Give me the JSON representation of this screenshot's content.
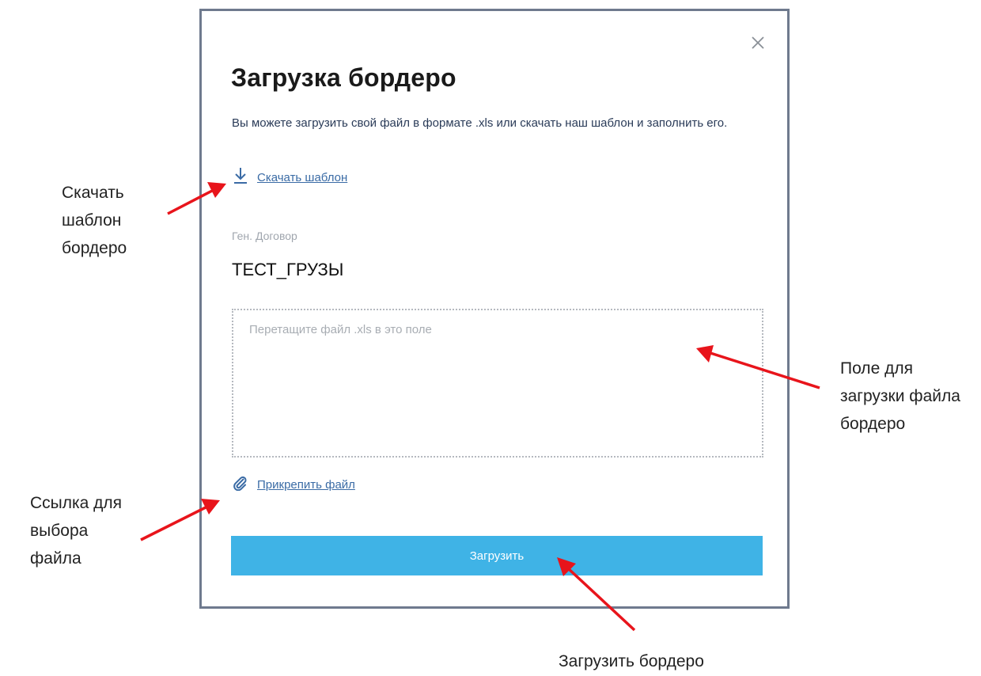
{
  "modal": {
    "title": "Загрузка бордеро",
    "description": "Вы можете загрузить свой файл в формате .xls или скачать наш шаблон и заполнить его.",
    "download_template_label": "Скачать шаблон",
    "contract_label": "Ген. Договор",
    "contract_value": "ТЕСТ_ГРУЗЫ",
    "dropzone_placeholder": "Перетащите файл .xls в это поле",
    "attach_file_label": "Прикрепить файл",
    "upload_button_label": "Загрузить",
    "close_icon": "close-icon"
  },
  "annotations": {
    "download_template_line1": "Скачать",
    "download_template_line2": "шаблон",
    "download_template_line3": "бордеро",
    "dropzone_line1": "Поле для",
    "dropzone_line2": "загрузки файла",
    "dropzone_line3": "бордеро",
    "attach_line1": "Ссылка для",
    "attach_line2": "выбора",
    "attach_line3": "файла",
    "upload_caption": "Загрузить бордеро"
  },
  "colors": {
    "accent_button": "#3fb3e6",
    "link": "#3a6ba5",
    "modal_border": "#6f7a8e",
    "annotation_arrow": "#e8141b"
  },
  "icons": {
    "download": "download-icon",
    "attach": "paperclip-icon"
  }
}
